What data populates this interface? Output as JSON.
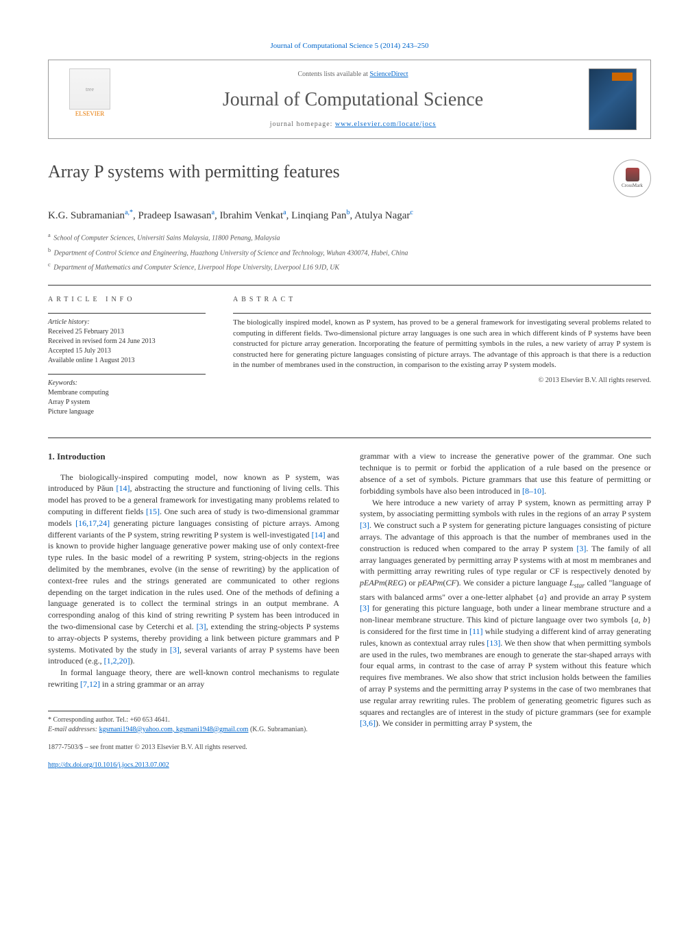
{
  "top_citation": "Journal of Computational Science 5 (2014) 243–250",
  "header": {
    "contents_prefix": "Contents lists available at ",
    "contents_link": "ScienceDirect",
    "journal_title": "Journal of Computational Science",
    "homepage_prefix": "journal homepage: ",
    "homepage_url": "www.elsevier.com/locate/jocs",
    "publisher": "ELSEVIER"
  },
  "crossmark_label": "CrossMark",
  "article_title": "Array P systems with permitting features",
  "authors_html": "K.G. Subramanian",
  "authors": [
    {
      "name": "K.G. Subramanian",
      "sup": "a,*"
    },
    {
      "name": "Pradeep Isawasan",
      "sup": "a"
    },
    {
      "name": "Ibrahim Venkat",
      "sup": "a"
    },
    {
      "name": "Linqiang Pan",
      "sup": "b"
    },
    {
      "name": "Atulya Nagar",
      "sup": "c"
    }
  ],
  "affiliations": [
    {
      "sup": "a",
      "text": "School of Computer Sciences, Universiti Sains Malaysia, 11800 Penang, Malaysia"
    },
    {
      "sup": "b",
      "text": "Department of Control Science and Engineering, Huazhong University of Science and Technology, Wuhan 430074, Hubei, China"
    },
    {
      "sup": "c",
      "text": "Department of Mathematics and Computer Science, Liverpool Hope University, Liverpool L16 9JD, UK"
    }
  ],
  "article_info": {
    "heading": "article info",
    "history_label": "Article history:",
    "history": [
      "Received 25 February 2013",
      "Received in revised form 24 June 2013",
      "Accepted 15 July 2013",
      "Available online 1 August 2013"
    ],
    "keywords_label": "Keywords:",
    "keywords": [
      "Membrane computing",
      "Array P system",
      "Picture language"
    ]
  },
  "abstract": {
    "heading": "abstract",
    "text": "The biologically inspired model, known as P system, has proved to be a general framework for investigating several problems related to computing in different fields. Two-dimensional picture array languages is one such area in which different kinds of P systems have been constructed for picture array generation. Incorporating the feature of permitting symbols in the rules, a new variety of array P system is constructed here for generating picture languages consisting of picture arrays. The advantage of this approach is that there is a reduction in the number of membranes used in the construction, in comparison to the existing array P system models.",
    "copyright": "© 2013 Elsevier B.V. All rights reserved."
  },
  "body": {
    "section_number": "1.",
    "section_title": "Introduction",
    "col1_p1": "The biologically-inspired computing model, now known as P system, was introduced by Păun [14], abstracting the structure and functioning of living cells. This model has proved to be a general framework for investigating many problems related to computing in different fields [15]. One such area of study is two-dimensional grammar models [16,17,24] generating picture languages consisting of picture arrays. Among different variants of the P system, string rewriting P system is well-investigated [14] and is known to provide higher language generative power making use of only context-free type rules. In the basic model of a rewriting P system, string-objects in the regions delimited by the membranes, evolve (in the sense of rewriting) by the application of context-free rules and the strings generated are communicated to other regions depending on the target indication in the rules used. One of the methods of defining a language generated is to collect the terminal strings in an output membrane. A corresponding analog of this kind of string rewriting P system has been introduced in the two-dimensional case by Ceterchi et al. [3], extending the string-objects P systems to array-objects P systems, thereby providing a link between picture grammars and P systems. Motivated by the study in [3], several variants of array P systems have been introduced (e.g., [1,2,20]).",
    "col1_p2": "In formal language theory, there are well-known control mechanisms to regulate rewriting [7,12] in a string grammar or an array",
    "col2_p1": "grammar with a view to increase the generative power of the grammar. One such technique is to permit or forbid the application of a rule based on the presence or absence of a set of symbols. Picture grammars that use this feature of permitting or forbidding symbols have also been introduced in [8–10].",
    "col2_p2": "We here introduce a new variety of array P system, known as permitting array P system, by associating permitting symbols with rules in the regions of an array P system [3]. We construct such a P system for generating picture languages consisting of picture arrays. The advantage of this approach is that the number of membranes used in the construction is reduced when compared to the array P system [3]. The family of all array languages generated by permitting array P systems with at most m membranes and with permitting array rewriting rules of type regular or CF is respectively denoted by pEAPm(REG) or pEAPm(CF). We consider a picture language Lstar called \"language of stars with balanced arms\" over a one-letter alphabet {a} and provide an array P system [3] for generating this picture language, both under a linear membrane structure and a non-linear membrane structure. This kind of picture language over two symbols {a, b} is considered for the first time in [11] while studying a different kind of array generating rules, known as contextual array rules [13]. We then show that when permitting symbols are used in the rules, two membranes are enough to generate the star-shaped arrays with four equal arms, in contrast to the case of array P system without this feature which requires five membranes. We also show that strict inclusion holds between the families of array P systems and the permitting array P systems in the case of two membranes that use regular array rewriting rules. The problem of generating geometric figures such as squares and rectangles are of interest in the study of picture grammars (see for example [3,6]). We consider in permitting array P system, the"
  },
  "footnotes": {
    "corresponding": "Corresponding author. Tel.: +60 653 4641.",
    "email_label": "E-mail addresses:",
    "emails": "kgsmani1948@yahoo.com, kgsmani1948@gmail.com",
    "email_owner": "(K.G. Subramanian)."
  },
  "doi": {
    "issn_line": "1877-7503/$ – see front matter © 2013 Elsevier B.V. All rights reserved.",
    "doi_url": "http://dx.doi.org/10.1016/j.jocs.2013.07.002"
  }
}
